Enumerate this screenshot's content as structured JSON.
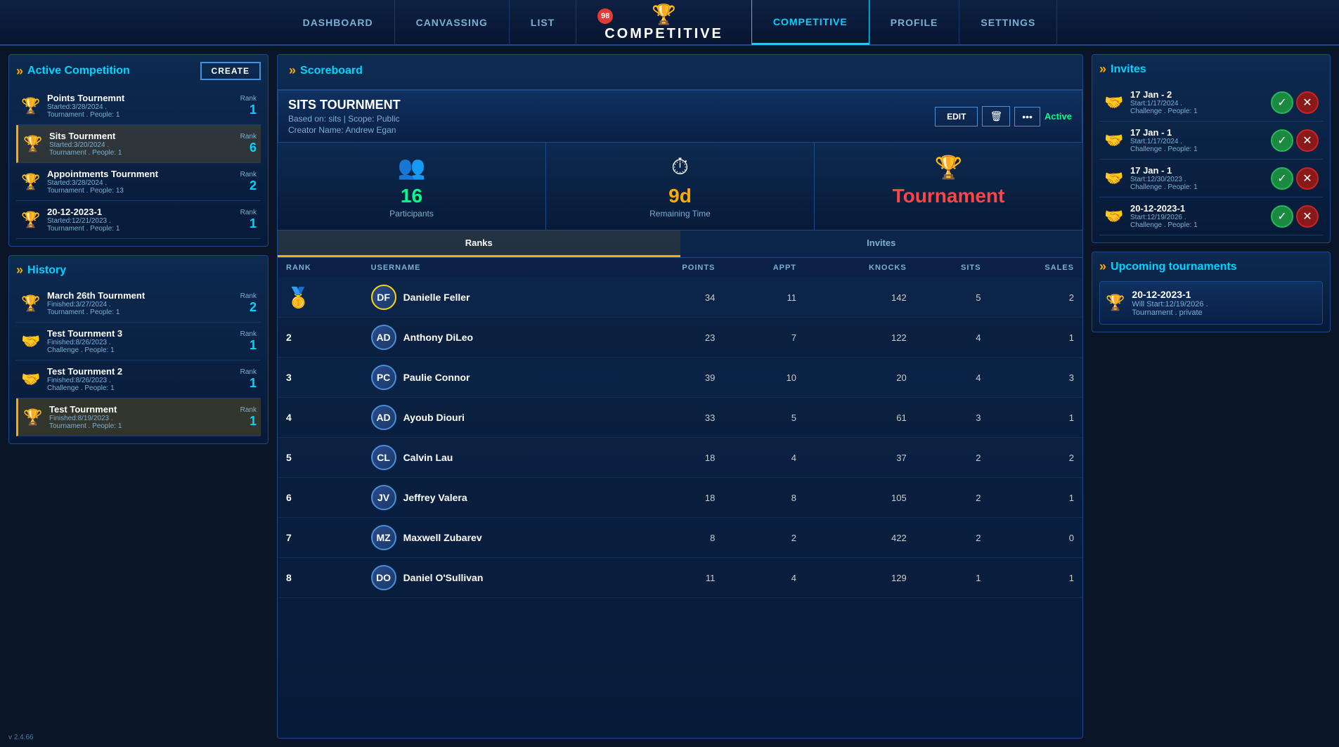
{
  "nav": {
    "left_items": [
      {
        "id": "dashboard",
        "label": "DASHBOARD"
      },
      {
        "id": "canvassing",
        "label": "CANVASSING"
      },
      {
        "id": "list",
        "label": "LIST"
      }
    ],
    "center": {
      "badge": "98",
      "title": "COMPETITIVE"
    },
    "right_items": [
      {
        "id": "competitive",
        "label": "COMPETITIVE",
        "active": true
      },
      {
        "id": "profile",
        "label": "PROFILE"
      },
      {
        "id": "settings",
        "label": "SETTINGS"
      }
    ]
  },
  "left_panel": {
    "active_competition": {
      "title": "Active Competition",
      "create_btn": "CREATE",
      "items": [
        {
          "name": "Points Tournemnt",
          "sub": "Started:3/28/2024 .\nTournament . People: 1",
          "rank": "1",
          "icon": "trophy_gold",
          "selected": false
        },
        {
          "name": "Sits Tournment",
          "sub": "Started:3/20/2024 .\nTournament . People: 1",
          "rank": "6",
          "icon": "trophy_silver",
          "selected": true
        },
        {
          "name": "Appointments Tournment",
          "sub": "Started:3/28/2024 .\nTournament . People: 13",
          "rank": "2",
          "icon": "trophy_silver",
          "selected": false
        },
        {
          "name": "20-12-2023-1",
          "sub": "Started:12/21/2023 .\nTournament . People: 1",
          "rank": "1",
          "icon": "trophy_silver",
          "selected": false
        }
      ]
    },
    "history": {
      "title": "History",
      "items": [
        {
          "name": "March 26th Tournment",
          "sub": "Finished:3/27/2024 .\nTournament . People: 1",
          "rank": "2",
          "icon": "trophy_silver",
          "highlighted": false
        },
        {
          "name": "Test Tournment 3",
          "sub": "Finished:8/26/2023 .\nChallenge . People: 1",
          "rank": "1",
          "icon": "handshake",
          "highlighted": false
        },
        {
          "name": "Test Tournment 2",
          "sub": "Finished:8/26/2023 .\nChallenge . People: 1",
          "rank": "1",
          "icon": "handshake",
          "highlighted": false
        },
        {
          "name": "Test Tournment",
          "sub": "Finished:8/19/2023 .\nTournament . People: 1",
          "rank": "1",
          "icon": "trophy_gold",
          "highlighted": true
        }
      ]
    }
  },
  "center_panel": {
    "title": "Scoreboard",
    "tournament": {
      "name": "SITS TOURNMENT",
      "meta1": "Based on: sits | Scope: Public",
      "meta2": "Creator Name: Andrew Egan",
      "status": "Active",
      "edit_btn": "EDIT"
    },
    "stats": [
      {
        "icon": "👥",
        "value": "16",
        "label": "Participants",
        "color": "green"
      },
      {
        "icon": "⏱",
        "value": "9d",
        "label": "Remaining Time",
        "color": "orange"
      },
      {
        "icon": "🏆",
        "value": "Tournament",
        "label": "",
        "color": "red"
      }
    ],
    "tabs": [
      {
        "id": "ranks",
        "label": "Ranks",
        "active": true
      },
      {
        "id": "invites",
        "label": "Invites",
        "active": false
      }
    ],
    "columns": [
      "RANK",
      "USERNAME",
      "POINTS",
      "APPT",
      "KNOCKS",
      "SITS",
      "SALES"
    ],
    "rows": [
      {
        "rank": "1",
        "username": "Danielle Feller",
        "points": "34",
        "appt": "11",
        "knocks": "142",
        "sits": "5",
        "sales": "2",
        "first": true
      },
      {
        "rank": "2",
        "username": "Anthony DiLeo",
        "points": "23",
        "appt": "7",
        "knocks": "122",
        "sits": "4",
        "sales": "1",
        "first": false
      },
      {
        "rank": "3",
        "username": "Paulie Connor",
        "points": "39",
        "appt": "10",
        "knocks": "20",
        "sits": "4",
        "sales": "3",
        "first": false
      },
      {
        "rank": "4",
        "username": "Ayoub Diouri",
        "points": "33",
        "appt": "5",
        "knocks": "61",
        "sits": "3",
        "sales": "1",
        "first": false
      },
      {
        "rank": "5",
        "username": "Calvin Lau",
        "points": "18",
        "appt": "4",
        "knocks": "37",
        "sits": "2",
        "sales": "2",
        "first": false
      },
      {
        "rank": "6",
        "username": "Jeffrey Valera",
        "points": "18",
        "appt": "8",
        "knocks": "105",
        "sits": "2",
        "sales": "1",
        "first": false
      },
      {
        "rank": "7",
        "username": "Maxwell Zubarev",
        "points": "8",
        "appt": "2",
        "knocks": "422",
        "sits": "2",
        "sales": "0",
        "first": false
      },
      {
        "rank": "8",
        "username": "Daniel O'Sullivan",
        "points": "11",
        "appt": "4",
        "knocks": "129",
        "sits": "1",
        "sales": "1",
        "first": false
      }
    ]
  },
  "right_panel": {
    "invites": {
      "title": "Invites",
      "items": [
        {
          "name": "17 Jan - 2",
          "sub": "Start:1/17/2024 .\nChallenge . People: 1"
        },
        {
          "name": "17 Jan - 1",
          "sub": "Start:1/17/2024 .\nChallenge . People: 1"
        },
        {
          "name": "17 Jan - 1",
          "sub": "Start:12/30/2023 .\nChallenge . People: 1"
        },
        {
          "name": "20-12-2023-1",
          "sub": "Start:12/19/2026 .\nChallenge . People: 1"
        }
      ]
    },
    "upcoming": {
      "title": "Upcoming tournaments",
      "items": [
        {
          "name": "20-12-2023-1",
          "sub": "Will Start:12/19/2026 .\nTournament . private"
        }
      ]
    }
  },
  "version": "v 2.4.66"
}
